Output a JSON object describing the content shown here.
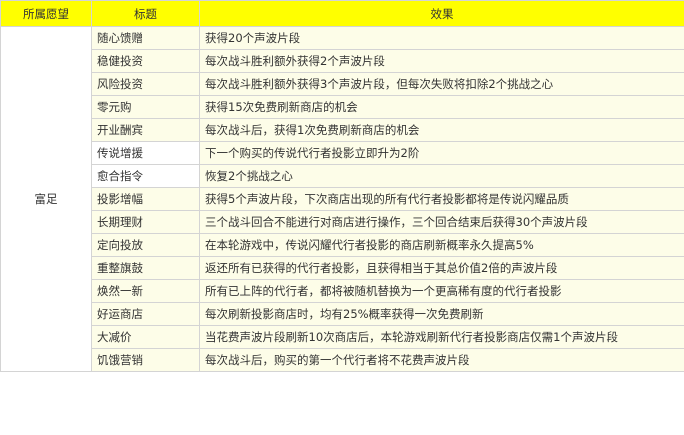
{
  "headers": [
    "所属愿望",
    "标题",
    "效果"
  ],
  "group": "富足",
  "rows": [
    {
      "title": "随心馈赠",
      "effect": "获得20个声波片段"
    },
    {
      "title": "稳健投资",
      "effect": "每次战斗胜利额外获得2个声波片段"
    },
    {
      "title": "风险投资",
      "effect": "每次战斗胜利额外获得3个声波片段，但每次失败将扣除2个挑战之心"
    },
    {
      "title": "零元购",
      "effect": "获得15次免费刷新商店的机会"
    },
    {
      "title": "开业酬宾",
      "effect": "每次战斗后，获得1次免费刷新商店的机会"
    },
    {
      "title": "传说增援",
      "effect": "下一个购买的传说代行者投影立即升为2阶"
    },
    {
      "title": "愈合指令",
      "effect": "恢复2个挑战之心"
    },
    {
      "title": "投影增幅",
      "effect": "获得5个声波片段，下次商店出现的所有代行者投影都将是传说闪耀品质"
    },
    {
      "title": "长期理财",
      "effect": "三个战斗回合不能进行对商店进行操作，三个回合结束后获得30个声波片段"
    },
    {
      "title": "定向投放",
      "effect": "在本轮游戏中，传说闪耀代行者投影的商店刷新概率永久提高5%"
    },
    {
      "title": "重整旗鼓",
      "effect": "返还所有已获得的代行者投影，且获得相当于其总价值2倍的声波片段"
    },
    {
      "title": "焕然一新",
      "effect": "所有已上阵的代行者，都将被随机替换为一个更高稀有度的代行者投影"
    },
    {
      "title": "好运商店",
      "effect": "每次刷新投影商店时，均有25%概率获得一次免费刷新"
    },
    {
      "title": "大减价",
      "effect": "当花费声波片段刷新10次商店后，本轮游戏刷新代行者投影商店仅需1个声波片段"
    },
    {
      "title": "饥饿营销",
      "effect": "每次战斗后，购买的第一个代行者将不花费声波片段"
    }
  ]
}
